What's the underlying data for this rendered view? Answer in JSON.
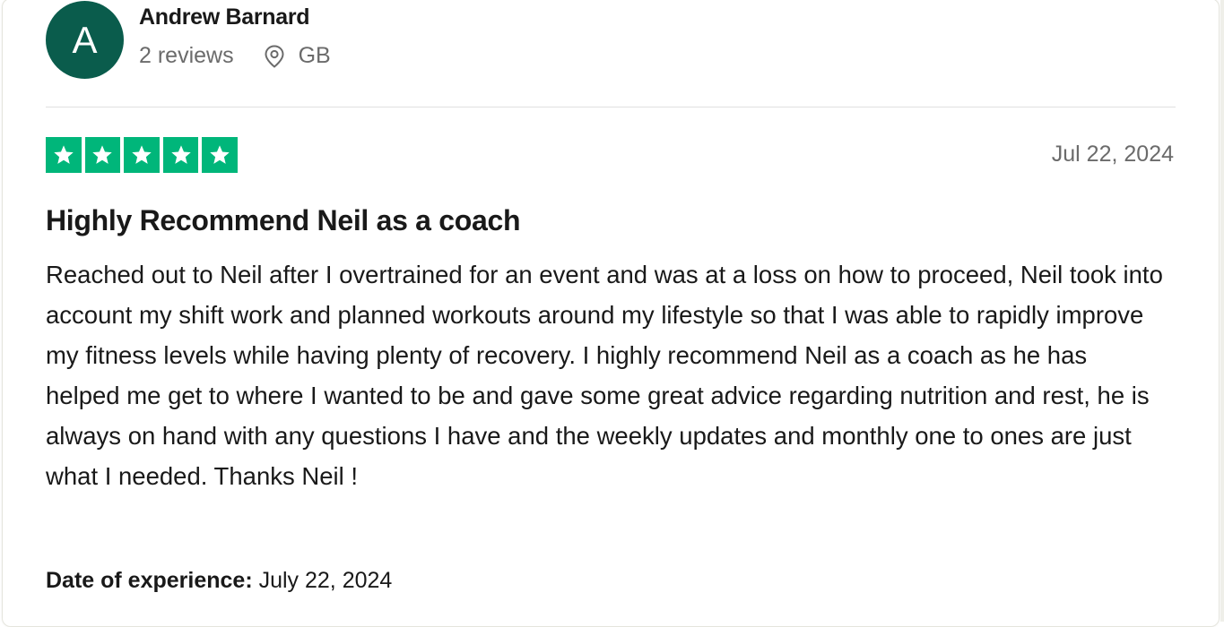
{
  "reviewer": {
    "avatar_initial": "A",
    "avatar_color": "#0a5c4c",
    "name": "Andrew Barnard",
    "review_count": "2 reviews",
    "location_icon": "location-pin-icon",
    "country": "GB"
  },
  "review": {
    "rating": 5,
    "max_rating": 5,
    "star_color": "#00b67a",
    "date": "Jul 22, 2024",
    "title": "Highly Recommend Neil as a coach",
    "body": "Reached out to Neil after I overtrained for an event and was at a loss on how to proceed, Neil took into account my shift work and planned workouts around my lifestyle so that I was able to rapidly improve my fitness levels while having plenty of recovery. I highly recommend Neil as a coach as he has helped me get to where I wanted to be and gave some great advice regarding nutrition and rest, he is always on hand with any questions I have and the weekly updates and monthly one to ones are just what I needed. Thanks Neil !",
    "experience_label": "Date of experience:",
    "experience_date": "July 22, 2024"
  }
}
